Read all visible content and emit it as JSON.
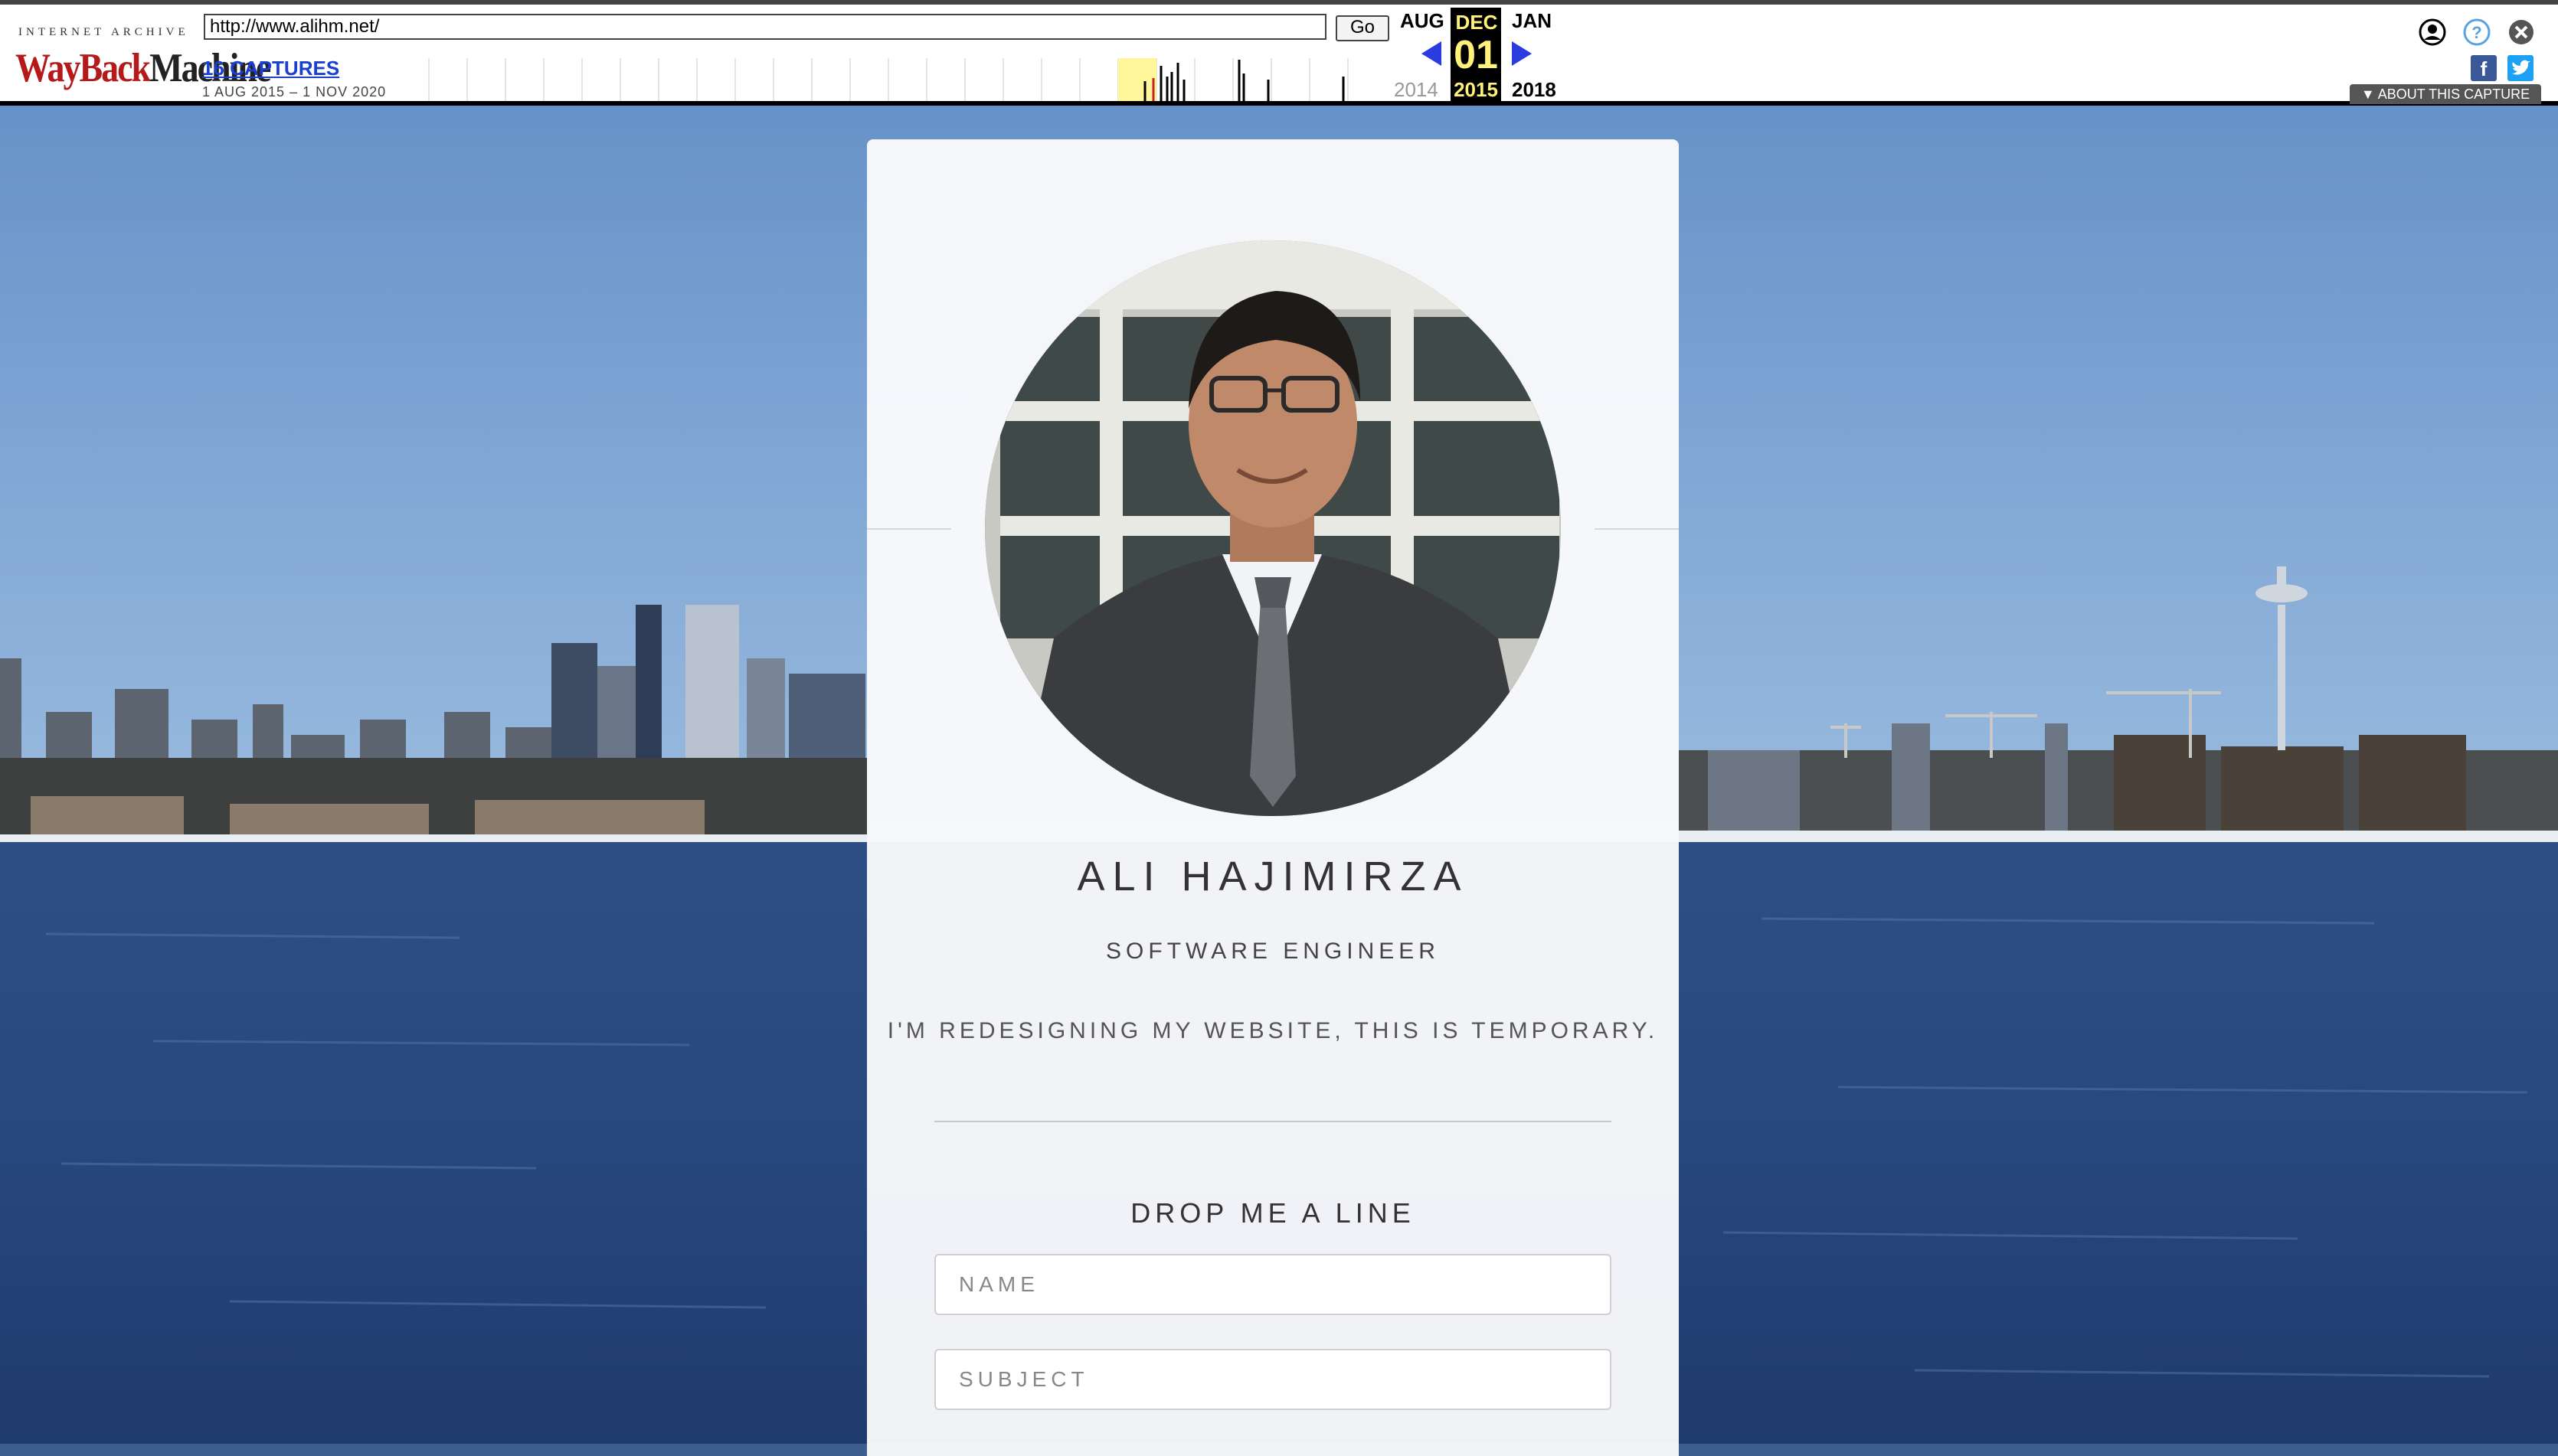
{
  "wayback": {
    "logo_top": "INTERNET ARCHIVE",
    "logo_word1": "WayBack",
    "logo_word2": "Machine",
    "url_value": "http://www.alihm.net/",
    "go_label": "Go",
    "captures_label": "16 CAPTURES",
    "capture_range": "1 AUG 2015 – 1 NOV 2020",
    "prev_month": "AUG",
    "current_month": "DEC",
    "next_month": "JAN",
    "prev_year": "2014",
    "current_day": "01",
    "current_year": "2015",
    "next_year": "2018",
    "about_label": "ABOUT THIS CAPTURE",
    "icons": [
      "user-icon",
      "help-icon",
      "close-icon",
      "facebook-icon",
      "twitter-icon"
    ],
    "accent_color": "#2b3be0",
    "highlight_color": "#fff17a"
  },
  "profile": {
    "name": "ALI HAJIMIRZA",
    "role": "SOFTWARE ENGINEER",
    "tagline": "I'M REDESIGNING MY WEBSITE, THIS IS TEMPORARY."
  },
  "contact": {
    "title": "DROP ME A LINE",
    "name_placeholder": "NAME",
    "subject_placeholder": "SUBJECT"
  }
}
